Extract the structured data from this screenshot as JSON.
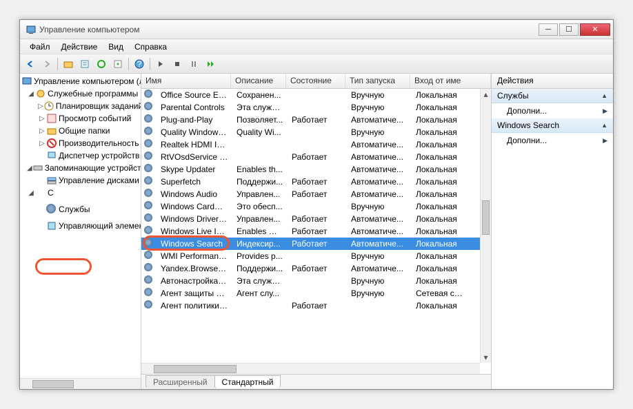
{
  "window": {
    "title": "Управление компьютером"
  },
  "menubar": [
    "Файл",
    "Действие",
    "Вид",
    "Справка"
  ],
  "tree": {
    "root": "Управление компьютером (л",
    "group1": "Служебные программы",
    "items1": [
      "Планировщик заданий",
      "Просмотр событий",
      "Общие папки",
      "Производительность",
      "Диспетчер устройств"
    ],
    "group2": "Запоминающие устройст",
    "items2": [
      "Управление дисками"
    ],
    "group3_prefix": "С",
    "services": "Службы",
    "last": "Управляющий элемен"
  },
  "columns": {
    "name": "Имя",
    "desc": "Описание",
    "state": "Состояние",
    "startup": "Тип запуска",
    "logon": "Вход от име"
  },
  "col_widths": {
    "name": 130,
    "desc": 80,
    "state": 86,
    "startup": 94,
    "logon": 80
  },
  "services": [
    {
      "name": "Office Source Engi...",
      "desc": "Сохранен...",
      "state": "",
      "startup": "Вручную",
      "logon": "Локальная"
    },
    {
      "name": "Parental Controls",
      "desc": "Эта служб...",
      "state": "",
      "startup": "Вручную",
      "logon": "Локальная"
    },
    {
      "name": "Plug-and-Play",
      "desc": "Позволяет...",
      "state": "Работает",
      "startup": "Автоматиче...",
      "logon": "Локальная"
    },
    {
      "name": "Quality Windows ...",
      "desc": "Quality Wi...",
      "state": "",
      "startup": "Вручную",
      "logon": "Локальная"
    },
    {
      "name": "Realtek HDMI In...",
      "desc": "",
      "state": "",
      "startup": "Автоматиче...",
      "logon": "Локальная"
    },
    {
      "name": "RtVOsdService In...",
      "desc": "",
      "state": "Работает",
      "startup": "Автоматиче...",
      "logon": "Локальная"
    },
    {
      "name": "Skype Updater",
      "desc": "Enables th...",
      "state": "",
      "startup": "Автоматиче...",
      "logon": "Локальная"
    },
    {
      "name": "Superfetch",
      "desc": "Поддержи...",
      "state": "Работает",
      "startup": "Автоматиче...",
      "logon": "Локальная"
    },
    {
      "name": "Windows Audio",
      "desc": "Управлен...",
      "state": "Работает",
      "startup": "Автоматиче...",
      "logon": "Локальная"
    },
    {
      "name": "Windows CardSpa...",
      "desc": "Это обесп...",
      "state": "",
      "startup": "Вручную",
      "logon": "Локальная"
    },
    {
      "name": "Windows Driver F...",
      "desc": "Управлен...",
      "state": "Работает",
      "startup": "Автоматиче...",
      "logon": "Локальная"
    },
    {
      "name": "Windows Live ID S...",
      "desc": "Enables Wi...",
      "state": "Работает",
      "startup": "Автоматиче...",
      "logon": "Локальная"
    },
    {
      "name": "Windows Search",
      "desc": "Индексир...",
      "state": "Работает",
      "startup": "Автоматиче...",
      "logon": "Локальная",
      "selected": true
    },
    {
      "name": "WMI Performance...",
      "desc": "Provides p...",
      "state": "",
      "startup": "Вручную",
      "logon": "Локальная"
    },
    {
      "name": "Yandex.Browser U...",
      "desc": "Поддержи...",
      "state": "Работает",
      "startup": "Автоматиче...",
      "logon": "Локальная"
    },
    {
      "name": "Автонастройка W...",
      "desc": "Эта служб...",
      "state": "",
      "startup": "Вручную",
      "logon": "Локальная"
    },
    {
      "name": "Агент защиты сет...",
      "desc": "Агент слу...",
      "state": "",
      "startup": "Вручную",
      "logon": "Сетевая слу"
    },
    {
      "name": "Агент политики I...",
      "desc": "",
      "state": "Работает",
      "startup": "",
      "logon": "Локальная"
    }
  ],
  "tabs": {
    "extended": "Расширенный",
    "standard": "Стандартный"
  },
  "actions": {
    "header": "Действия",
    "group1": "Службы",
    "item1": "Дополни...",
    "group2": "Windows Search",
    "item2": "Дополни..."
  }
}
